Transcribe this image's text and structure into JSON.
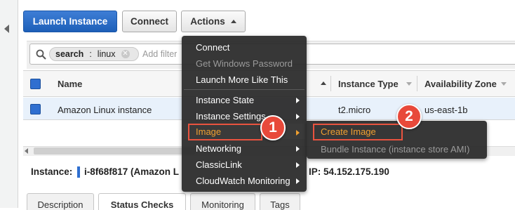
{
  "toolbar": {
    "launch_label": "Launch Instance",
    "connect_label": "Connect",
    "actions_label": "Actions"
  },
  "search": {
    "tag_key": "search",
    "tag_sep": ":",
    "tag_value": "linux",
    "placeholder": "Add filter"
  },
  "table": {
    "columns": [
      "Name",
      "Instance Type",
      "Availability Zone"
    ],
    "rows": [
      {
        "name": "Amazon Linux instance",
        "type": "t2.micro",
        "zone": "us-east-1b"
      }
    ]
  },
  "instance_detail": {
    "label": "Instance:",
    "id_text": "i-8f68f817 (Amazon L",
    "ip_text": "IP: 54.152.175.190"
  },
  "tabs": [
    "Description",
    "Status Checks",
    "Monitoring",
    "Tags"
  ],
  "actions_menu": {
    "items": [
      {
        "label": "Connect",
        "enabled": true
      },
      {
        "label": "Get Windows Password",
        "enabled": false
      },
      {
        "label": "Launch More Like This",
        "enabled": true
      },
      {
        "label": "Instance State",
        "submenu": true
      },
      {
        "label": "Instance Settings",
        "submenu": true
      },
      {
        "label": "Image",
        "submenu": true,
        "highlighted": true
      },
      {
        "label": "Networking",
        "submenu": true
      },
      {
        "label": "ClassicLink",
        "submenu": true
      },
      {
        "label": "CloudWatch Monitoring",
        "submenu": true
      }
    ]
  },
  "image_submenu": {
    "items": [
      {
        "label": "Create Image",
        "highlighted": true
      },
      {
        "label": "Bundle Instance (instance store AMI)",
        "enabled": false
      }
    ]
  },
  "callouts": [
    "1",
    "2"
  ],
  "colors": {
    "primary_button": "#2a6bc8",
    "menu_background": "#282828",
    "highlight_orange": "#f0a030",
    "callout_red": "#e8493a"
  }
}
